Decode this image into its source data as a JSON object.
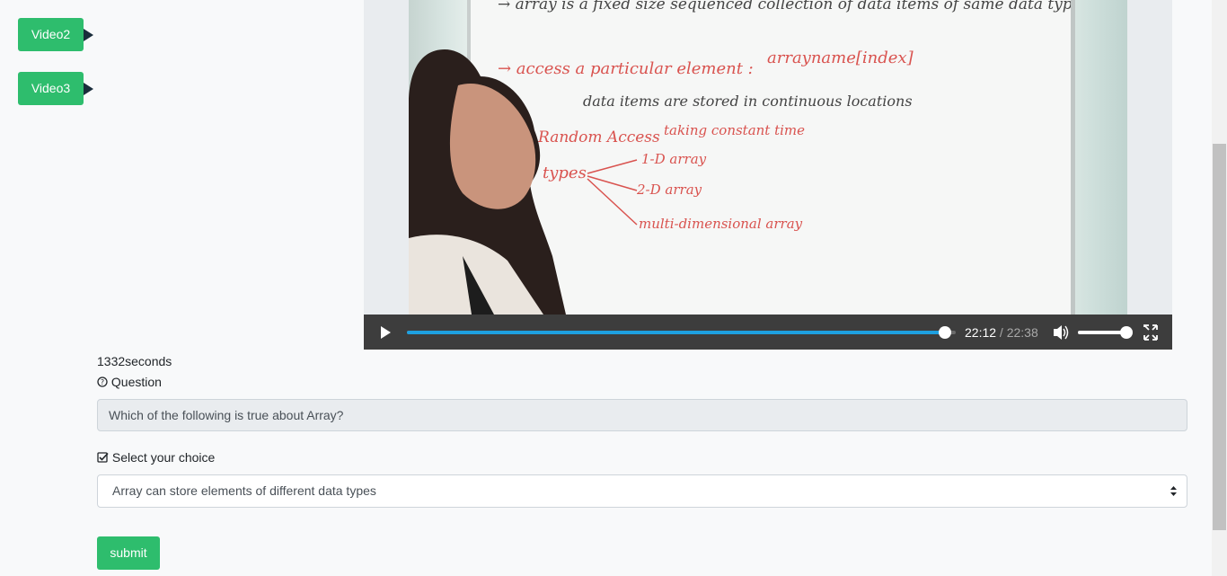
{
  "sidebar": {
    "buttons": [
      {
        "label": "Video2"
      },
      {
        "label": "Video3"
      }
    ]
  },
  "player": {
    "current_time": "22:12",
    "separator": " / ",
    "duration": "22:38",
    "progress_fraction": 0.98,
    "volume_fraction": 1.0,
    "board_text": {
      "line1": "→ array is a fixed size sequenced collection of data items of same data type",
      "line2": "→ access a particular element :",
      "line2b": "arrayname[index]",
      "line3": "data items are stored in continuous locations",
      "line4": "Random Access",
      "line4b": "taking constant time",
      "types": "types",
      "t1": "1-D array",
      "t2": "2-D array",
      "t3": "multi-dimensional array"
    }
  },
  "timer": {
    "text": "1332seconds"
  },
  "question": {
    "label": "Question",
    "text": "Which of the following is true about Array?"
  },
  "choice": {
    "label": "Select your choice",
    "selected": "Array can store elements of different data types"
  },
  "submit": {
    "label": "submit"
  },
  "colors": {
    "accent": "#2ebd6d",
    "progress": "#1ea0e0",
    "controls_bg": "#3d3d3d"
  }
}
